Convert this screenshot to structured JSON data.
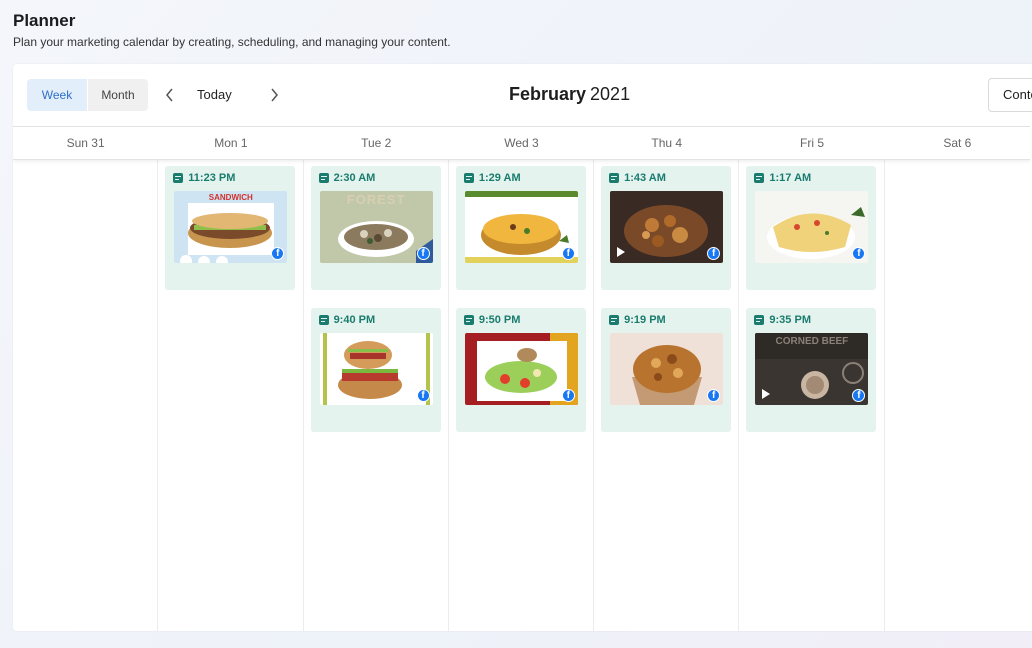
{
  "page": {
    "title": "Planner",
    "subtitle": "Plan your marketing calendar by creating, scheduling, and managing your content."
  },
  "toolbar": {
    "views": [
      {
        "label": "Week",
        "active": true
      },
      {
        "label": "Month",
        "active": false
      }
    ],
    "today_label": "Today",
    "month": "February",
    "year": "2021",
    "content_button": "Conte"
  },
  "days": [
    "Sun 31",
    "Mon 1",
    "Tue 2",
    "Wed 3",
    "Thu 4",
    "Fri 5",
    "Sat 6"
  ],
  "posts": [
    {
      "day": 1,
      "row": 0,
      "time": "11:23 PM",
      "thumb": "sandwich",
      "caption": "SANDWICH",
      "video": false,
      "network_icon": "facebook-icon"
    },
    {
      "day": 2,
      "row": 0,
      "time": "2:30 AM",
      "thumb": "forest",
      "caption": "FOREST",
      "video": false,
      "network_icon": "facebook-icon"
    },
    {
      "day": 3,
      "row": 0,
      "time": "1:29 AM",
      "thumb": "quiche",
      "caption": "",
      "video": false,
      "network_icon": "facebook-icon"
    },
    {
      "day": 4,
      "row": 0,
      "time": "1:43 AM",
      "thumb": "curry",
      "caption": "",
      "video": true,
      "network_icon": "facebook-icon"
    },
    {
      "day": 5,
      "row": 0,
      "time": "1:17 AM",
      "thumb": "frittata",
      "caption": "",
      "video": false,
      "network_icon": "facebook-icon"
    },
    {
      "day": 2,
      "row": 1,
      "time": "9:40 PM",
      "thumb": "sub",
      "caption": "",
      "video": false,
      "network_icon": "facebook-icon"
    },
    {
      "day": 3,
      "row": 1,
      "time": "9:50 PM",
      "thumb": "salad",
      "caption": "",
      "video": false,
      "network_icon": "facebook-icon"
    },
    {
      "day": 4,
      "row": 1,
      "time": "9:19 PM",
      "thumb": "muffin",
      "caption": "",
      "video": false,
      "network_icon": "facebook-icon"
    },
    {
      "day": 5,
      "row": 1,
      "time": "9:35 PM",
      "thumb": "cornedbeef",
      "caption": "CORNED BEEF",
      "video": true,
      "network_icon": "facebook-icon"
    }
  ],
  "colors": {
    "card_bg": "#e4f3ee",
    "card_time": "#1a7c6e",
    "active_view_bg": "#e3eefb",
    "active_view_text": "#2f6fc7",
    "facebook": "#1877f2"
  }
}
